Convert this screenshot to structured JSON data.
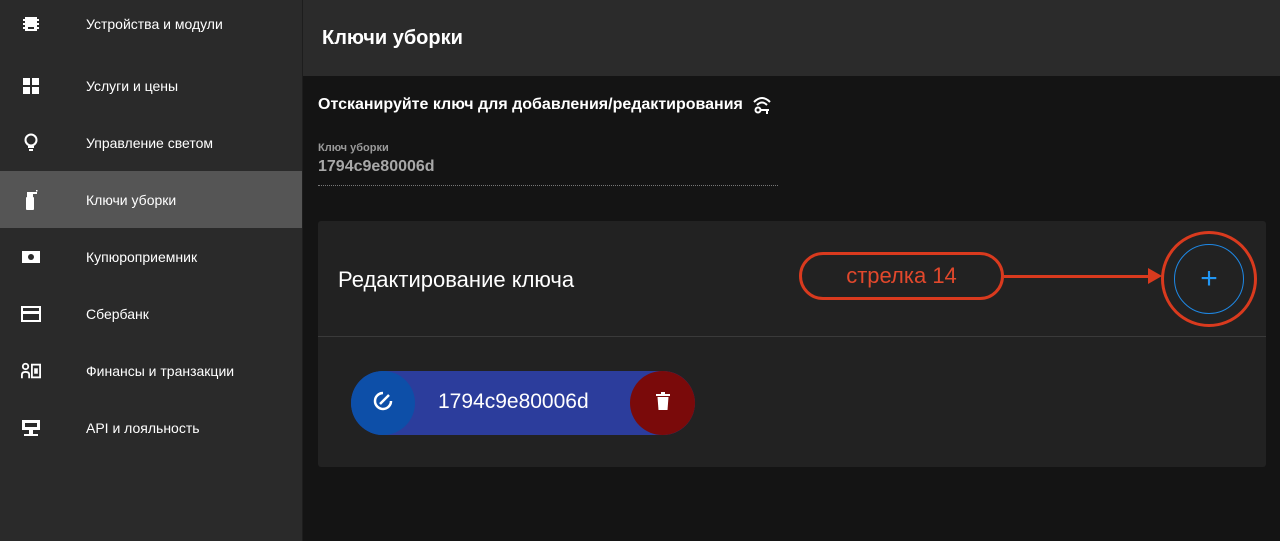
{
  "sidebar": {
    "items": [
      {
        "label": "Устройства и модули",
        "icon": "chip-icon"
      },
      {
        "label": "Услуги и цены",
        "icon": "grid-icon"
      },
      {
        "label": "Управление светом",
        "icon": "lightbulb-icon"
      },
      {
        "label": "Ключи уборки",
        "icon": "spray-bottle-icon",
        "active": true
      },
      {
        "label": "Купюроприемник",
        "icon": "banknote-icon"
      },
      {
        "label": "Сбербанк",
        "icon": "credit-card-icon"
      },
      {
        "label": "Финансы и транзакции",
        "icon": "finance-icon"
      },
      {
        "label": "API и лояльность",
        "icon": "api-icon"
      }
    ]
  },
  "header": {
    "title": "Ключи уборки"
  },
  "scan": {
    "title": "Отсканируйте ключ для добавления/редактирования",
    "icon": "key-wireless-icon"
  },
  "field": {
    "label": "Ключ уборки",
    "value": "1794c9e80006d"
  },
  "card": {
    "title": "Редактирование ключа",
    "add_label": "+"
  },
  "annotation": {
    "callout": "стрелка 14",
    "color": "#d93a1e"
  },
  "chip": {
    "key": "1794c9e80006d"
  },
  "colors": {
    "accent": "#2196f3",
    "chip": "#2c3d9c",
    "delete": "#7a0a0a",
    "active_nav": "#555555"
  }
}
